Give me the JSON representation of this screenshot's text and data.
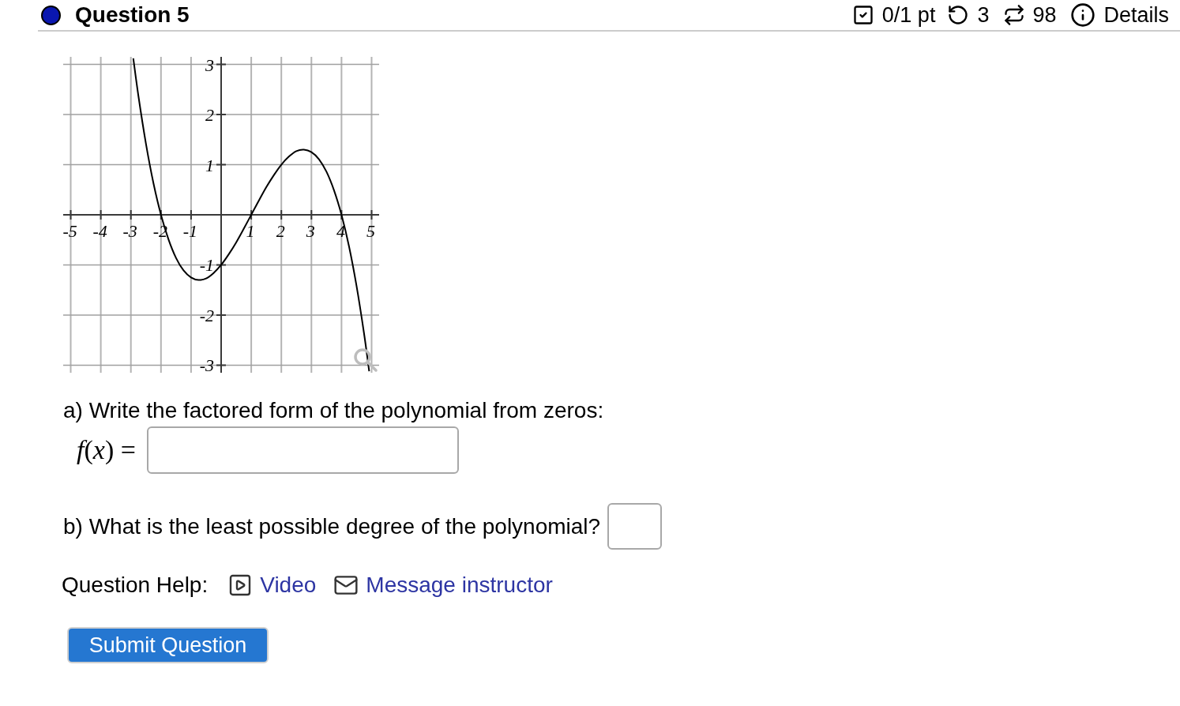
{
  "header": {
    "title": "Question 5",
    "score": "0/1 pt",
    "retries": "3",
    "attempts": "98",
    "details": "Details"
  },
  "graph": {
    "chart_data": [
      {
        "type": "line",
        "xlim": [
          -5.25,
          5.25
        ],
        "ylim": [
          -3.15,
          3.15
        ],
        "xticks": [
          -5,
          -4,
          -3,
          -2,
          -1,
          1,
          2,
          3,
          4,
          5
        ],
        "yticks": [
          3,
          2,
          1,
          -1,
          -2,
          -3
        ],
        "grid": true,
        "x": [
          -2.92,
          -2.75,
          -2.5,
          -2.25,
          -2,
          -1.75,
          -1.5,
          -1.25,
          -1,
          -0.75,
          -0.5,
          -0.25,
          0,
          0.25,
          0.5,
          0.75,
          1,
          1.25,
          1.5,
          1.75,
          2,
          2.25,
          2.5,
          2.75,
          3,
          3.25,
          3.5,
          3.75,
          4,
          4.25,
          4.5,
          4.75,
          4.92
        ],
        "values": [
          3.12,
          2.37,
          1.42,
          0.63,
          0,
          -0.49,
          -0.86,
          -1.11,
          -1.25,
          -1.3,
          -1.27,
          -1.16,
          -1,
          -0.79,
          -0.55,
          -0.28,
          0,
          0.28,
          0.55,
          0.79,
          1,
          1.16,
          1.27,
          1.3,
          1.25,
          1.11,
          0.86,
          0.49,
          0,
          -0.63,
          -1.42,
          -2.37,
          -3.12
        ],
        "color": "#000000"
      }
    ]
  },
  "part_a": {
    "prompt": "a) Write the factored form of the polynomial from zeros:",
    "label": "*f*(*x*) ="
  },
  "part_b": {
    "prompt": "b) What is the least possible degree of the polynomial?"
  },
  "help": {
    "label": "Question Help:",
    "links": [
      {
        "kind": "video",
        "label": "Video"
      },
      {
        "kind": "message",
        "label": "Message instructor"
      }
    ]
  },
  "submit": "Submit Question"
}
